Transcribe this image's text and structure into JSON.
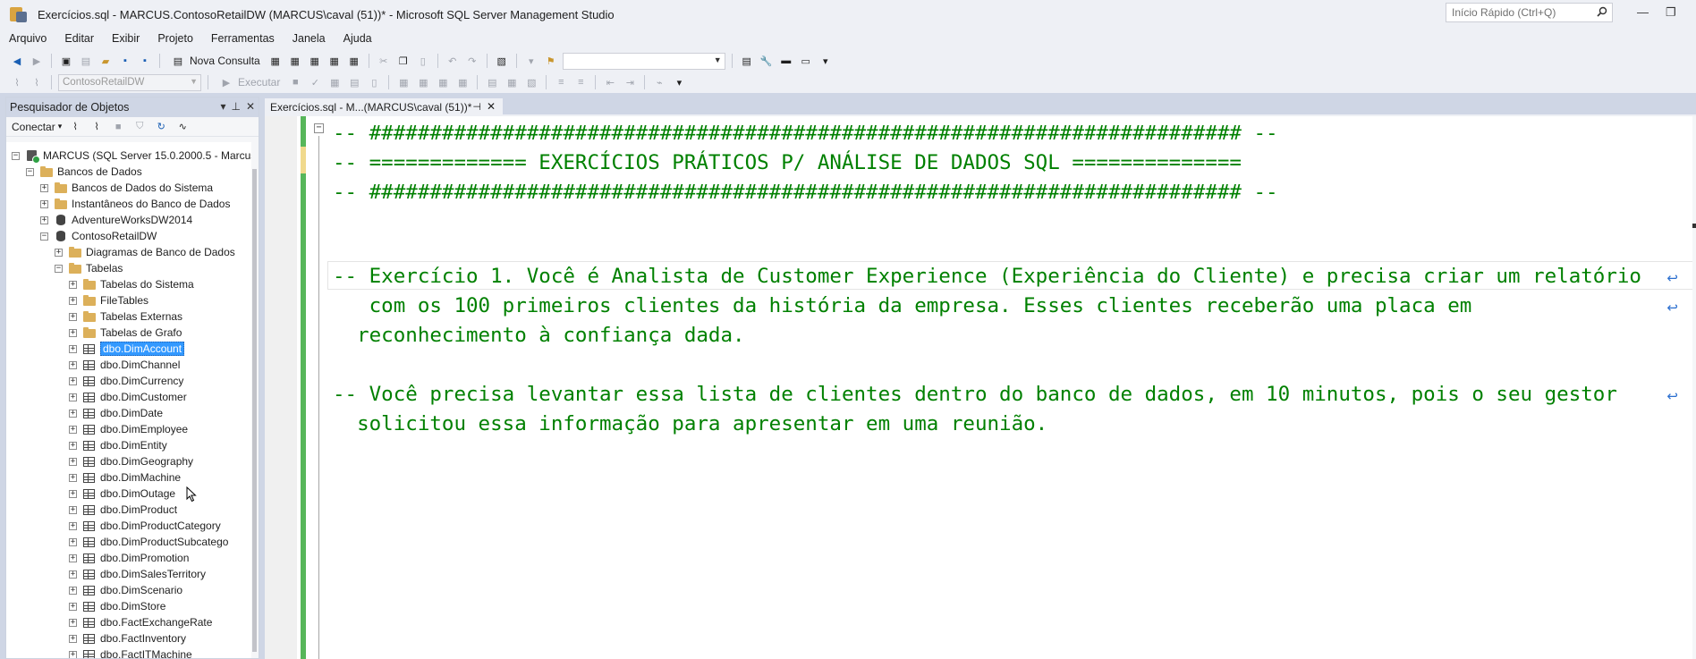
{
  "window": {
    "title": "Exercícios.sql - MARCUS.ContosoRetailDW (MARCUS\\caval (51))* - Microsoft SQL Server Management Studio",
    "quick_launch_placeholder": "Início Rápido (Ctrl+Q)",
    "minimize_glyph": "—",
    "restore_glyph": "❐"
  },
  "menu": [
    "Arquivo",
    "Editar",
    "Exibir",
    "Projeto",
    "Ferramentas",
    "Janela",
    "Ajuda"
  ],
  "toolbar": {
    "new_query_label": "Nova Consulta",
    "database_selector": "ContosoRetailDW",
    "execute_label": "Executar"
  },
  "object_explorer": {
    "title": "Pesquisador de Objetos",
    "connect_label": "Conectar",
    "tree": [
      {
        "label": "MARCUS (SQL Server 15.0.2000.5 - Marcus",
        "icon": "server-icon",
        "expander": "−"
      },
      {
        "label": "Bancos de Dados",
        "icon": "folder-icon",
        "expander": "−"
      },
      {
        "label": "Bancos de Dados do Sistema",
        "icon": "folder-icon",
        "expander": "+"
      },
      {
        "label": "Instantâneos do Banco de Dados",
        "icon": "folder-icon",
        "expander": "+"
      },
      {
        "label": "AdventureWorksDW2014",
        "icon": "database-icon",
        "expander": "+"
      },
      {
        "label": "ContosoRetailDW",
        "icon": "database-icon",
        "expander": "−"
      },
      {
        "label": "Diagramas de Banco de Dados",
        "icon": "folder-icon",
        "expander": "+"
      },
      {
        "label": "Tabelas",
        "icon": "folder-icon",
        "expander": "−"
      },
      {
        "label": "Tabelas do Sistema",
        "icon": "folder-icon",
        "expander": "+"
      },
      {
        "label": "FileTables",
        "icon": "folder-icon",
        "expander": "+"
      },
      {
        "label": "Tabelas Externas",
        "icon": "folder-icon",
        "expander": "+"
      },
      {
        "label": "Tabelas de Grafo",
        "icon": "folder-icon",
        "expander": "+"
      },
      {
        "label": "dbo.DimAccount",
        "icon": "table-icon",
        "expander": "+",
        "selected": true
      },
      {
        "label": "dbo.DimChannel",
        "icon": "table-icon",
        "expander": "+"
      },
      {
        "label": "dbo.DimCurrency",
        "icon": "table-icon",
        "expander": "+"
      },
      {
        "label": "dbo.DimCustomer",
        "icon": "table-icon",
        "expander": "+"
      },
      {
        "label": "dbo.DimDate",
        "icon": "table-icon",
        "expander": "+"
      },
      {
        "label": "dbo.DimEmployee",
        "icon": "table-icon",
        "expander": "+"
      },
      {
        "label": "dbo.DimEntity",
        "icon": "table-icon",
        "expander": "+"
      },
      {
        "label": "dbo.DimGeography",
        "icon": "table-icon",
        "expander": "+"
      },
      {
        "label": "dbo.DimMachine",
        "icon": "table-icon",
        "expander": "+"
      },
      {
        "label": "dbo.DimOutage",
        "icon": "table-icon",
        "expander": "+"
      },
      {
        "label": "dbo.DimProduct",
        "icon": "table-icon",
        "expander": "+"
      },
      {
        "label": "dbo.DimProductCategory",
        "icon": "table-icon",
        "expander": "+"
      },
      {
        "label": "dbo.DimProductSubcatego",
        "icon": "table-icon",
        "expander": "+"
      },
      {
        "label": "dbo.DimPromotion",
        "icon": "table-icon",
        "expander": "+"
      },
      {
        "label": "dbo.DimSalesTerritory",
        "icon": "table-icon",
        "expander": "+"
      },
      {
        "label": "dbo.DimScenario",
        "icon": "table-icon",
        "expander": "+"
      },
      {
        "label": "dbo.DimStore",
        "icon": "table-icon",
        "expander": "+"
      },
      {
        "label": "dbo.FactExchangeRate",
        "icon": "table-icon",
        "expander": "+"
      },
      {
        "label": "dbo.FactInventory",
        "icon": "table-icon",
        "expander": "+"
      },
      {
        "label": "dbo.FactITMachine",
        "icon": "table-icon",
        "expander": "+"
      }
    ]
  },
  "document_tab": {
    "label": "Exercícios.sql - M...(MARCUS\\caval (51))*",
    "pin_glyph": "⊣",
    "close_glyph": "✕"
  },
  "editor": {
    "lines": [
      {
        "text": "-- ######################################################################## --",
        "wrapped": false
      },
      {
        "text": "-- ============= EXERCÍCIOS PRÁTICOS P/ ANÁLISE DE DADOS SQL ==============",
        "wrapped": false
      },
      {
        "text": "-- ######################################################################## --",
        "wrapped": false
      },
      {
        "text": "",
        "wrapped": false
      },
      {
        "text": "",
        "wrapped": false
      },
      {
        "text": "-- Exercício 1. Você é Analista de Customer Experience (Experiência do Cliente) e precisa criar um relatório",
        "wrapped": true
      },
      {
        "text": "   com os 100 primeiros clientes da história da empresa. Esses clientes receberão uma placa em",
        "wrapped": true
      },
      {
        "text": "  reconhecimento à confiança dada.",
        "wrapped": false
      },
      {
        "text": "",
        "wrapped": false
      },
      {
        "text": "-- Você precisa levantar essa lista de clientes dentro do banco de dados, em 10 minutos, pois o seu gestor",
        "wrapped": true
      },
      {
        "text": "  solicitou essa informação para apresentar em uma reunião.",
        "wrapped": false
      }
    ],
    "comment_color": "#008000"
  }
}
